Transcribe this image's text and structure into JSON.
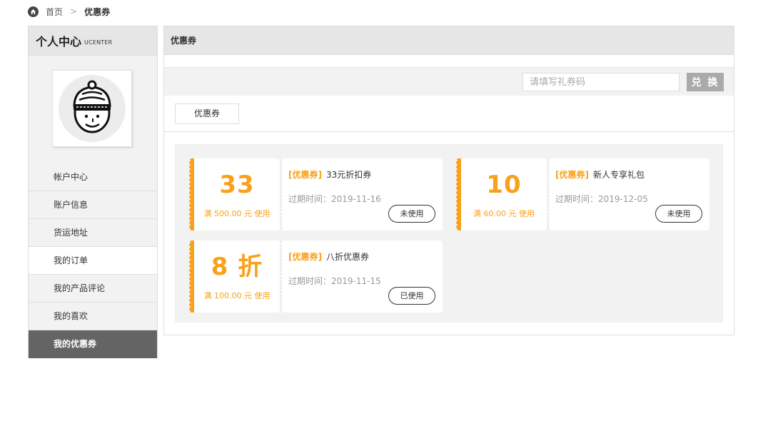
{
  "breadcrumb": {
    "home": "首页",
    "separator": ">",
    "current": "优惠券"
  },
  "sidebar": {
    "title": "个人中心",
    "subtitle": "UCENTER",
    "items": [
      {
        "label": "帐户中心"
      },
      {
        "label": "账户信息"
      },
      {
        "label": "货运地址"
      },
      {
        "label": "我的订单"
      },
      {
        "label": "我的产品评论"
      },
      {
        "label": "我的喜欢"
      },
      {
        "label": "我的优惠券"
      }
    ]
  },
  "main": {
    "title": "优惠券",
    "redeem": {
      "placeholder": "请填写礼券码",
      "button": "兑 换"
    },
    "tab": "优惠券"
  },
  "coupons": [
    {
      "amount": "33",
      "condition": "满 500.00 元 使用",
      "tag": "[优惠券]",
      "name": "33元折扣券",
      "expire": "过期时间：2019-11-16",
      "status": "未使用"
    },
    {
      "amount": "10",
      "condition": "满 60.00 元 使用",
      "tag": "[优惠券]",
      "name": "新人专享礼包",
      "expire": "过期时间：2019-12-05",
      "status": "未使用"
    },
    {
      "amount": "8 折",
      "condition": "满 100.00 元 使用",
      "tag": "[优惠券]",
      "name": "八折优惠券",
      "expire": "过期时间：2019-11-15",
      "status": "已使用"
    }
  ],
  "colors": {
    "accent": "#f9a11b",
    "sidebar_active": "#646464",
    "header_bg": "#e6e6e6"
  }
}
